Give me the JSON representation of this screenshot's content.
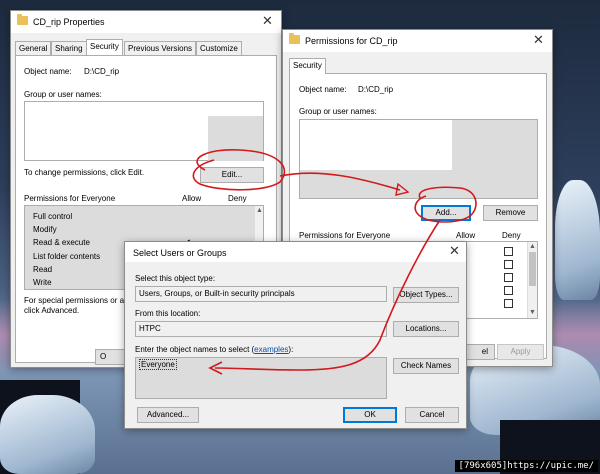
{
  "props_window": {
    "title": "CD_rip Properties",
    "tabs": [
      {
        "label": "General"
      },
      {
        "label": "Sharing"
      },
      {
        "label": "Security"
      },
      {
        "label": "Previous Versions"
      },
      {
        "label": "Customize"
      }
    ],
    "object_name_label": "Object name:",
    "object_name_value": "D:\\CD_rip",
    "group_label": "Group or user names:",
    "change_text": "To change permissions, click Edit.",
    "edit_button": "Edit...",
    "perm_for_label": "Permissions for Everyone",
    "allow_label": "Allow",
    "deny_label": "Deny",
    "permissions": [
      {
        "label": "Full control"
      },
      {
        "label": "Modify"
      },
      {
        "label": "Read & execute"
      },
      {
        "label": "List folder contents"
      },
      {
        "label": "Read"
      },
      {
        "label": "Write"
      }
    ],
    "check_glyph": "✔",
    "special_text_1": "For special permissions or ad",
    "special_text_2": "click Advanced.",
    "ok_fragment": "O"
  },
  "perm_window": {
    "title": "Permissions for CD_rip",
    "tab": "Security",
    "object_name_label": "Object name:",
    "object_name_value": "D:\\CD_rip",
    "group_label": "Group or user names:",
    "add_button": "Add...",
    "remove_button": "Remove",
    "perm_for_label": "Permissions for Everyone",
    "allow_label": "Allow",
    "deny_label": "Deny",
    "cancel_fragment": "el",
    "apply_button": "Apply"
  },
  "select_dialog": {
    "title": "Select Users or Groups",
    "object_type_label": "Select this object type:",
    "object_type_value": "Users, Groups, or Built-in security principals",
    "object_types_button": "Object Types...",
    "location_label": "From this location:",
    "location_value": "HTPC",
    "locations_button": "Locations...",
    "enter_label": "Enter the object names to select (",
    "examples_link": "examples",
    "enter_label_end": "):",
    "names_value": "Everyone",
    "check_names_button": "Check Names",
    "advanced_button": "Advanced...",
    "ok_button": "OK",
    "cancel_button": "Cancel"
  },
  "close_glyph": "✕",
  "watermark": "[796x605]https://upic.me/"
}
